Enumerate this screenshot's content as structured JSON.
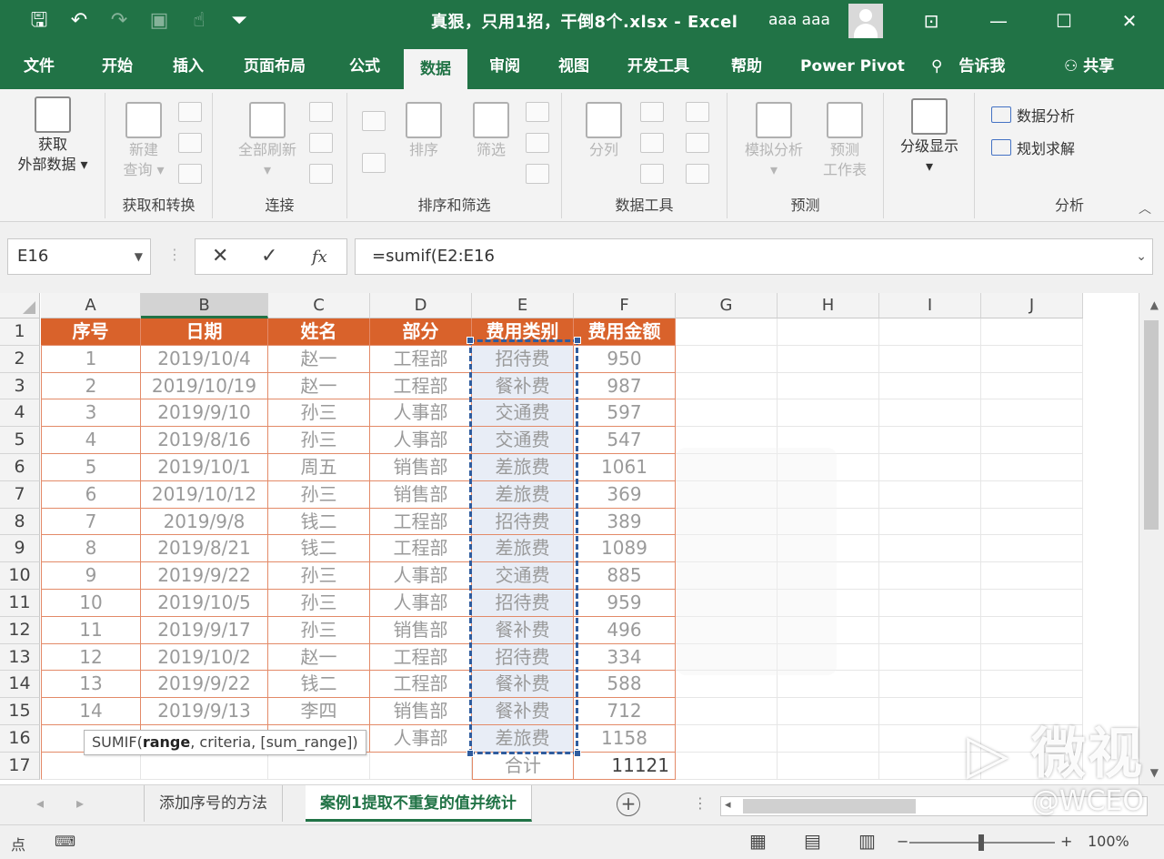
{
  "titlebar": {
    "doc_title": "真狠，只用1招，干倒8个.xlsx  -  Excel",
    "user": "aaa aaa",
    "qat_icons": [
      "save-icon",
      "undo-icon",
      "redo-icon",
      "print-preview-icon",
      "touch-mode-icon",
      "customize-icon"
    ],
    "window_icons": [
      "ribbon-display-icon",
      "minimize-icon",
      "maximize-icon",
      "close-icon"
    ],
    "glyphs": {
      "save": "🖫",
      "undo": "↶",
      "redo": "↷",
      "preview": "▣",
      "touch": "☝",
      "customize": "⏷",
      "ribbon_display": "⊡",
      "minimize": "—",
      "maximize": "☐",
      "close": "✕"
    }
  },
  "tabs": [
    {
      "label": "文件"
    },
    {
      "label": "开始"
    },
    {
      "label": "插入"
    },
    {
      "label": "页面布局"
    },
    {
      "label": "公式"
    },
    {
      "label": "数据"
    },
    {
      "label": "审阅"
    },
    {
      "label": "视图"
    },
    {
      "label": "开发工具"
    },
    {
      "label": "帮助"
    },
    {
      "label": "Power Pivot"
    }
  ],
  "tell_me": {
    "icon": "lightbulb-icon",
    "label": "告诉我"
  },
  "share": {
    "icon": "user-share-icon",
    "label": "共享"
  },
  "ribbon": {
    "get_external": {
      "line1": "获取",
      "line2": "外部数据 ▾"
    },
    "get_transform": {
      "new_query_1": "新建",
      "new_query_2": "查询 ▾",
      "label": "获取和转换"
    },
    "connections": {
      "refresh_all": "全部刷新",
      "label": "连接"
    },
    "sort_filter": {
      "sort": "排序",
      "filter": "筛选",
      "label": "排序和筛选"
    },
    "data_tools": {
      "split": "分列",
      "label": "数据工具"
    },
    "forecast": {
      "whatif": "模拟分析",
      "sheet_1": "预测",
      "sheet_2": "工作表",
      "label": "预测"
    },
    "outline": {
      "label": "分级显示"
    },
    "analysis": {
      "data_analysis": "数据分析",
      "solver": "规划求解",
      "label": "分析"
    },
    "collapse_glyph": "︿"
  },
  "formula_bar": {
    "name_box": "E16",
    "formula": "=sumif(E2:E16",
    "cancel_glyph": "✕",
    "enter_glyph": "✓",
    "fx_glyph": "fx"
  },
  "sheet": {
    "columns": [
      "A",
      "B",
      "C",
      "D",
      "E",
      "F",
      "G",
      "H",
      "I",
      "J"
    ],
    "headers": [
      "序号",
      "日期",
      "姓名",
      "部分",
      "费用类别",
      "费用金额"
    ],
    "rows": [
      [
        "1",
        "2019/10/4",
        "赵一",
        "工程部",
        "招待费",
        "950"
      ],
      [
        "2",
        "2019/10/19",
        "赵一",
        "工程部",
        "餐补费",
        "987"
      ],
      [
        "3",
        "2019/9/10",
        "孙三",
        "人事部",
        "交通费",
        "597"
      ],
      [
        "4",
        "2019/8/16",
        "孙三",
        "人事部",
        "交通费",
        "547"
      ],
      [
        "5",
        "2019/10/1",
        "周五",
        "销售部",
        "差旅费",
        "1061"
      ],
      [
        "6",
        "2019/10/12",
        "孙三",
        "销售部",
        "差旅费",
        "369"
      ],
      [
        "7",
        "2019/9/8",
        "钱二",
        "工程部",
        "招待费",
        "389"
      ],
      [
        "8",
        "2019/8/21",
        "钱二",
        "工程部",
        "差旅费",
        "1089"
      ],
      [
        "9",
        "2019/9/22",
        "孙三",
        "人事部",
        "交通费",
        "885"
      ],
      [
        "10",
        "2019/10/5",
        "孙三",
        "人事部",
        "招待费",
        "959"
      ],
      [
        "11",
        "2019/9/17",
        "孙三",
        "销售部",
        "餐补费",
        "496"
      ],
      [
        "12",
        "2019/10/2",
        "赵一",
        "工程部",
        "招待费",
        "334"
      ],
      [
        "13",
        "2019/9/22",
        "钱二",
        "工程部",
        "餐补费",
        "588"
      ],
      [
        "14",
        "2019/9/13",
        "李四",
        "销售部",
        "餐补费",
        "712"
      ],
      [
        "",
        "",
        "",
        "人事部",
        "差旅费",
        "1158"
      ]
    ],
    "total_label": "合计",
    "total_value": "11121",
    "tooltip": {
      "fn": "SUMIF(",
      "arg1": "range",
      "rest": ", criteria, [sum_range])"
    }
  },
  "sheet_tabs": [
    {
      "label": "添加序号的方法",
      "active": false
    },
    {
      "label": "案例1提取不重复的值并统计",
      "active": true
    }
  ],
  "sheet_nav": {
    "prev": "◂",
    "next": "▸",
    "add": "+",
    "more": "⋮",
    "hscroll_left": "◂"
  },
  "status": {
    "mode": "点",
    "zoom": "100%",
    "zoom_minus": "−",
    "zoom_plus": "+",
    "view_glyphs": [
      "▦",
      "▤",
      "▥"
    ]
  },
  "watermark": {
    "logo": "▷ 微视",
    "handle": "@WCEO"
  }
}
